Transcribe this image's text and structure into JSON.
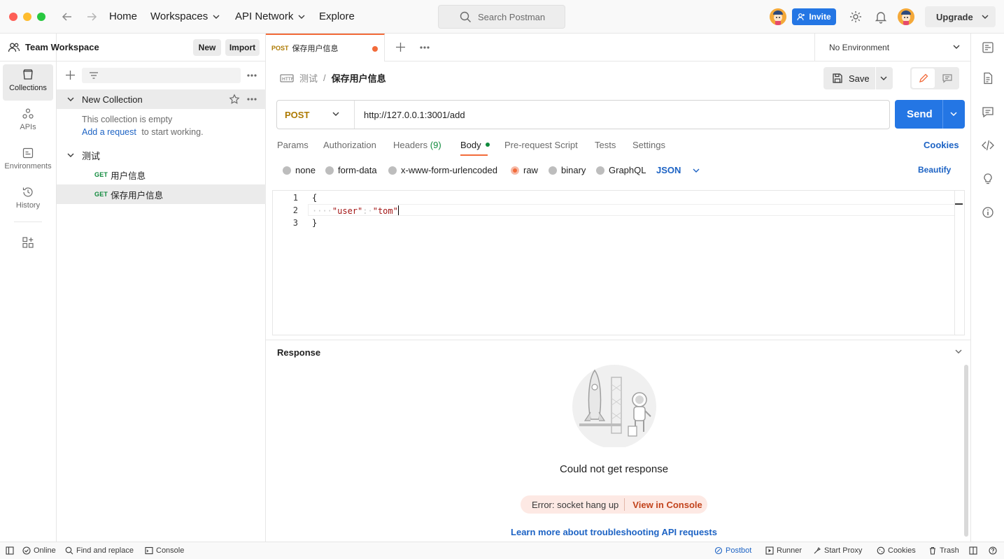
{
  "topbar": {
    "home": "Home",
    "workspaces": "Workspaces",
    "api_network": "API Network",
    "explore": "Explore",
    "search_placeholder": "Search Postman",
    "invite": "Invite",
    "upgrade": "Upgrade"
  },
  "rail": {
    "collections": "Collections",
    "apis": "APIs",
    "environments": "Environments",
    "history": "History"
  },
  "sidebar": {
    "workspace_name": "Team Workspace",
    "new_btn": "New",
    "import_btn": "Import",
    "collections": [
      {
        "name": "New Collection",
        "empty_text": "This collection is empty",
        "add_request": "Add a request",
        "empty_suffix": "to start working."
      },
      {
        "name": "测试",
        "requests": [
          {
            "method": "GET",
            "name": "用户信息"
          },
          {
            "method": "GET",
            "name": "保存用户信息"
          }
        ]
      }
    ]
  },
  "tabs": {
    "active": {
      "method": "POST",
      "name": "保存用户信息"
    },
    "environment": "No Environment"
  },
  "request": {
    "breadcrumb_parent": "测试",
    "breadcrumb_sep": "/",
    "breadcrumb_current": "保存用户信息",
    "save": "Save",
    "method": "POST",
    "url": "http://127.0.0.1:3001/add",
    "send": "Send",
    "tabs": {
      "params": "Params",
      "authorization": "Authorization",
      "headers": "Headers",
      "headers_count": "(9)",
      "body": "Body",
      "pre_request": "Pre-request Script",
      "tests": "Tests",
      "settings": "Settings"
    },
    "cookies": "Cookies",
    "body_types": {
      "none": "none",
      "form_data": "form-data",
      "urlencoded": "x-www-form-urlencoded",
      "raw": "raw",
      "binary": "binary",
      "graphql": "GraphQL"
    },
    "language": "JSON",
    "beautify": "Beautify",
    "code": {
      "line_numbers": [
        "1",
        "2",
        "3"
      ],
      "open_brace": "{",
      "indent": "····",
      "key": "\"user\"",
      "colon": ":·",
      "value": "\"tom\"",
      "close_brace": "}"
    }
  },
  "response": {
    "title": "Response",
    "no_response": "Could not get response",
    "error": "Error: socket hang up",
    "view_console": "View in Console",
    "learn_more": "Learn more about troubleshooting API requests"
  },
  "statusbar": {
    "online": "Online",
    "find_replace": "Find and replace",
    "console": "Console",
    "postbot": "Postbot",
    "runner": "Runner",
    "start_proxy": "Start Proxy",
    "cookies": "Cookies",
    "trash": "Trash"
  },
  "colors": {
    "accent_orange": "#f26b3a",
    "send_blue": "#2476e4",
    "link_blue": "#1d63c4",
    "get_green": "#0f8a3c",
    "post_gold": "#ad7a03"
  }
}
